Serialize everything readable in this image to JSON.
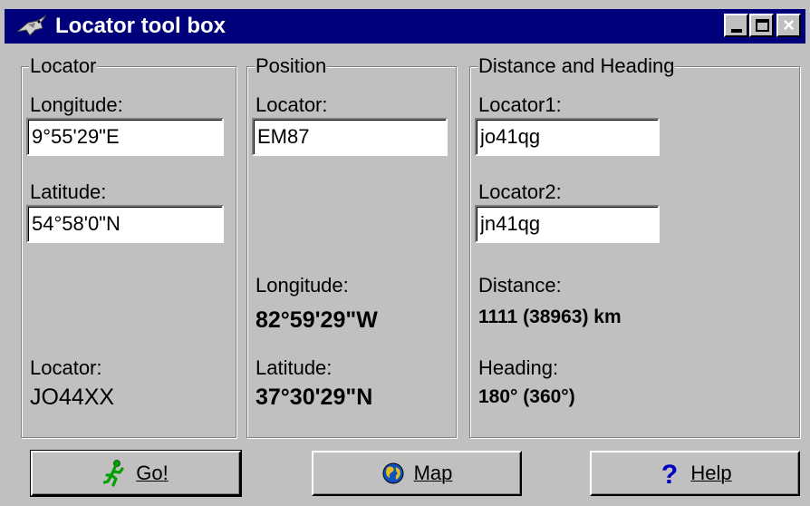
{
  "window": {
    "title": "Locator tool box",
    "title_icon": "swordfish-icon",
    "titlebar_color": "#00007b"
  },
  "locator_group": {
    "legend": "Locator",
    "longitude_label": "Longitude:",
    "longitude_value": "9°55'29\"E",
    "latitude_label": "Latitude:",
    "latitude_value": "54°58'0\"N",
    "locator_label": "Locator:",
    "locator_value": "JO44XX"
  },
  "position_group": {
    "legend": "Position",
    "locator_label": "Locator:",
    "locator_value": "EM87",
    "longitude_label": "Longitude:",
    "longitude_value": "82°59'29\"W",
    "latitude_label": "Latitude:",
    "latitude_value": "37°30'29\"N"
  },
  "distance_group": {
    "legend": "Distance and Heading",
    "locator1_label": "Locator1:",
    "locator1_value": "jo41qg",
    "locator2_label": "Locator2:",
    "locator2_value": "jn41qg",
    "distance_label": "Distance:",
    "distance_value": "1111 (38963) km",
    "heading_label": "Heading:",
    "heading_value": "180° (360°)"
  },
  "buttons": {
    "go": {
      "label": "Go!",
      "icon": "running-man-icon"
    },
    "map": {
      "label": "Map",
      "icon": "globe-icon"
    },
    "help": {
      "label": "Help",
      "icon": "question-mark-icon"
    }
  }
}
